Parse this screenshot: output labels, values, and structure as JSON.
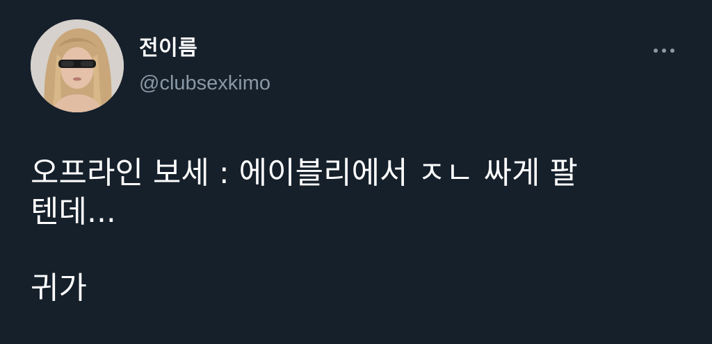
{
  "tweet": {
    "display_name": "전이름",
    "handle": "@clubsexkimo",
    "text_line1": "오프라인 보세 : 에이블리에서 ㅈㄴ 싸게 팔",
    "text_line2": "텐데...",
    "text_para2": "귀가"
  },
  "icons": {
    "more": "more-options-icon",
    "avatar": "profile-avatar"
  },
  "colors": {
    "background": "#15202b",
    "primary_text": "#ffffff",
    "secondary_text": "#8b98a5"
  }
}
